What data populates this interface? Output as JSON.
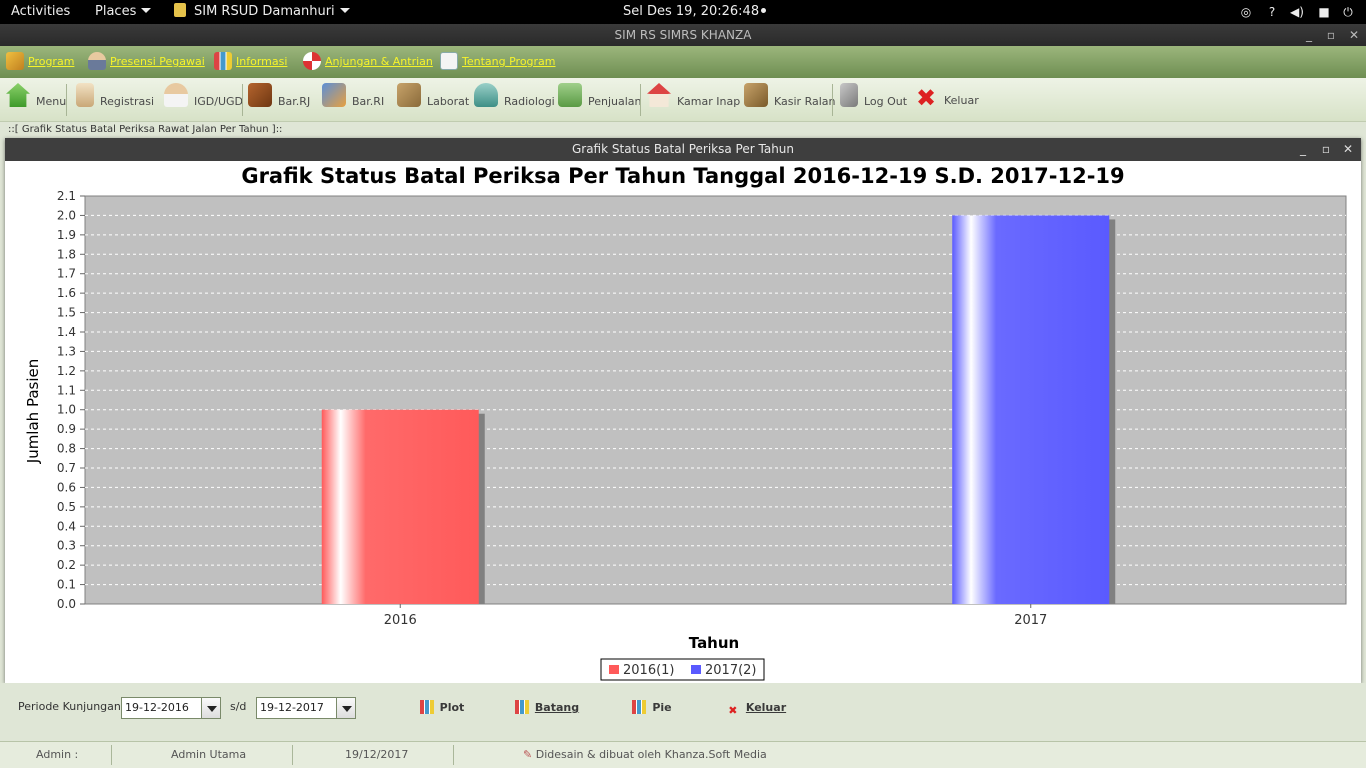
{
  "topbar": {
    "activities": "Activities",
    "places": "Places",
    "app_menu": "SIM RSUD Damanhuri",
    "clock": "Sel Des 19, 20:26:48",
    "tray_icons": [
      "accessibility-icon",
      "help-icon",
      "volume-icon",
      "battery-icon",
      "power-icon"
    ]
  },
  "window": {
    "title": "SIM RS SIMRS KHANZA"
  },
  "menubar": {
    "items": [
      {
        "label": "Program",
        "icon": "key-icon"
      },
      {
        "label": "Presensi Pegawai",
        "icon": "person-icon"
      },
      {
        "label": "Informasi",
        "icon": "chart-icon"
      },
      {
        "label": "Anjungan & Antrian",
        "icon": "lifebuoy-icon"
      },
      {
        "label": "Tentang Program",
        "icon": "notepad-icon"
      }
    ]
  },
  "toolbar": {
    "items": [
      {
        "label": "Menu",
        "icon": "home-icon"
      },
      {
        "label": "Registrasi",
        "icon": "register-icon"
      },
      {
        "label": "IGD/UGD",
        "icon": "doctor-icon"
      },
      {
        "label": "Bar.RJ",
        "icon": "book-icon"
      },
      {
        "label": "Bar.RI",
        "icon": "bed-icon"
      },
      {
        "label": "Laborat",
        "icon": "lab-icon"
      },
      {
        "label": "Radiologi",
        "icon": "radiology-icon"
      },
      {
        "label": "Penjualan",
        "icon": "cart-icon"
      },
      {
        "label": "Kamar Inap",
        "icon": "house-icon"
      },
      {
        "label": "Kasir Ralan",
        "icon": "cashier-icon"
      },
      {
        "label": "Log Out",
        "icon": "keys-icon"
      },
      {
        "label": "Keluar",
        "icon": "close-icon"
      }
    ]
  },
  "internal_frame_label": "::[ Grafik Status Batal Periksa Rawat Jalan Per Tahun ]::",
  "chart_window": {
    "title": "Grafik Status Batal Periksa Per Tahun"
  },
  "chart_data": {
    "type": "bar",
    "title": "Grafik Status Batal Periksa Per Tahun Tanggal 2016-12-19 S.D. 2017-12-19",
    "xlabel": "Tahun",
    "ylabel": "Jumlah Pasien",
    "categories": [
      "2016",
      "2017"
    ],
    "values": [
      1,
      2
    ],
    "colors": [
      "#ff5a5a",
      "#5a5aff"
    ],
    "ylim": [
      0,
      2.1
    ],
    "ytick_step": 0.1,
    "grid": true,
    "legend": [
      {
        "label": "2016(1)",
        "color": "#ff5a5a"
      },
      {
        "label": "2017(2)",
        "color": "#5a5aff"
      }
    ],
    "legend_position": "bottom"
  },
  "controls": {
    "periode_label": "Periode Kunjungan :",
    "date_from": "19-12-2016",
    "sd_label": "s/d",
    "date_to": "19-12-2017",
    "plot_label": "Plot",
    "batang_label": "Batang",
    "pie_label": "Pie",
    "keluar_label": "Keluar"
  },
  "statusbar": {
    "user_label": "Admin :",
    "user_name": "Admin Utama",
    "date": "19/12/2017",
    "credit": "Didesain & dibuat oleh Khanza.Soft Media"
  }
}
